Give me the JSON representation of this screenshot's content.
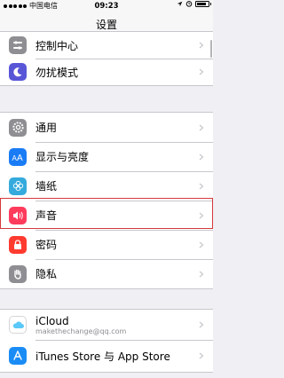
{
  "status_bar": {
    "carrier": "中国电信",
    "time": "09:23",
    "battery_level": 0.85
  },
  "nav": {
    "title": "设置"
  },
  "group1": [
    {
      "label": "控制中心",
      "icon": "control-center-icon",
      "color": "#8e8e93"
    },
    {
      "label": "勿扰模式",
      "icon": "moon-icon",
      "color": "#5856d6"
    }
  ],
  "group2": [
    {
      "label": "通用",
      "icon": "gear-icon",
      "color": "#8e8e93"
    },
    {
      "label": "显示与亮度",
      "icon": "display-brightness-icon",
      "color": "#1a7cf5"
    },
    {
      "label": "墙纸",
      "icon": "wallpaper-icon",
      "color": "#35aadc"
    },
    {
      "label": "声音",
      "icon": "speaker-icon",
      "color": "#ff3b5c"
    },
    {
      "label": "密码",
      "icon": "passcode-icon",
      "color": "#ff3b30"
    },
    {
      "label": "隐私",
      "icon": "hand-icon",
      "color": "#8e8e93"
    }
  ],
  "group3": [
    {
      "label": "iCloud",
      "sublabel": "makethechange@qq.com",
      "icon": "icloud-icon",
      "color": "#ffffff"
    },
    {
      "label": "iTunes Store 与 App Store",
      "icon": "app-store-icon",
      "color": "#1a8cf5"
    }
  ]
}
